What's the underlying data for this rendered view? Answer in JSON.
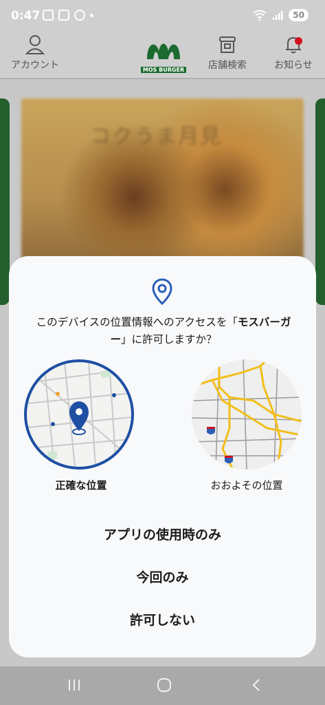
{
  "status_bar": {
    "time": "0:47",
    "battery": "50"
  },
  "header": {
    "account_label": "アカウント",
    "logo_text": "MOS BURGER",
    "stores_label": "店舗検索",
    "news_label": "お知らせ"
  },
  "banner": {
    "text": "コクうま月見"
  },
  "dialog": {
    "message_before": "このデバイスの位置情報へのアクセスを「",
    "app_name": "モスバーガー",
    "message_after": "」に許可しますか？",
    "precise_label": "正確な位置",
    "approximate_label": "おおよその位置",
    "choice_while_using": "アプリの使用時のみ",
    "choice_only_this_time": "今回のみ",
    "choice_deny": "許可しない"
  },
  "colors": {
    "accent_blue": "#1e4fa3",
    "brand_green": "#1b6b2e",
    "notification_red": "#d3101c"
  }
}
